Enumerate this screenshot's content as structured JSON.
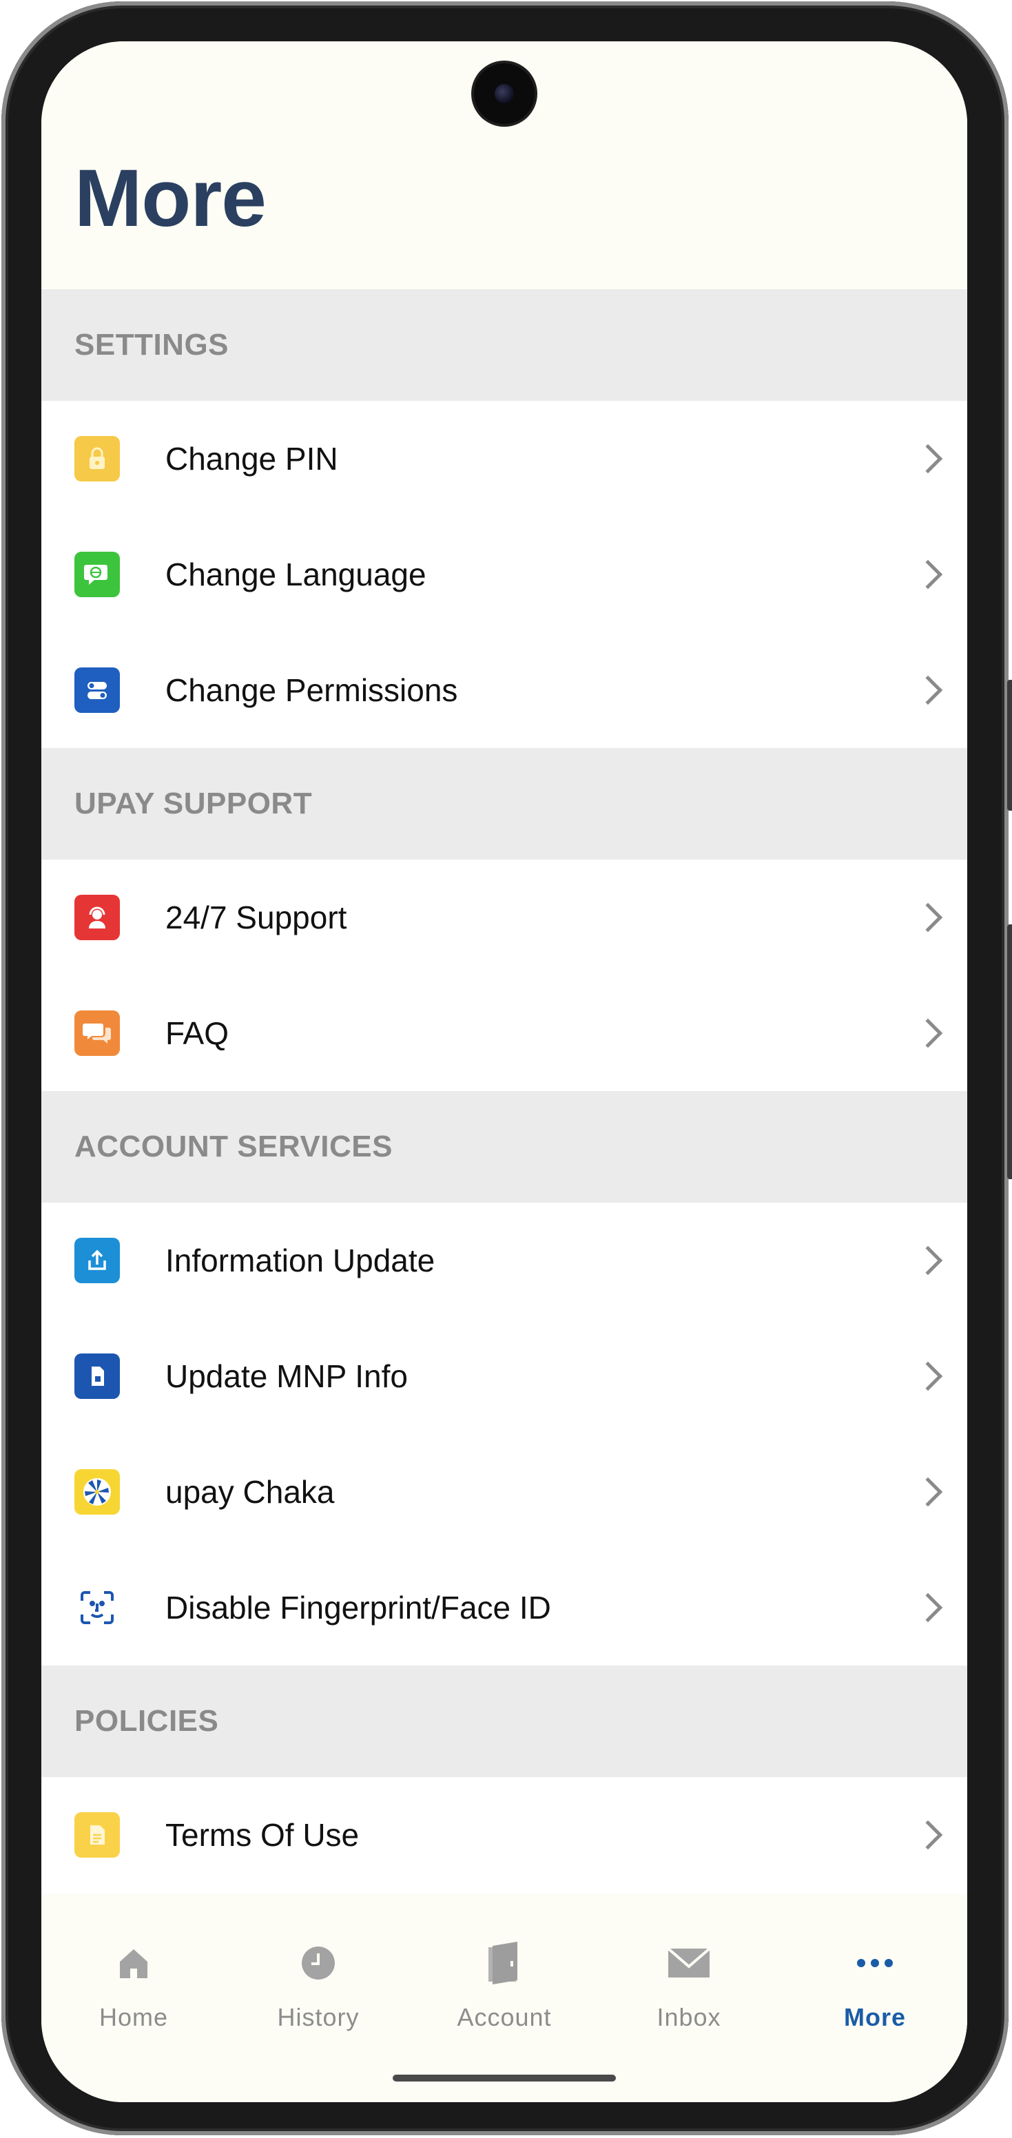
{
  "page": {
    "title": "More"
  },
  "sections": [
    {
      "title": "SETTINGS",
      "items": [
        {
          "label": "Change PIN",
          "icon": "lock-icon",
          "color": "#f7c948"
        },
        {
          "label": "Change Language",
          "icon": "language-icon",
          "color": "#3cc43c"
        },
        {
          "label": "Change Permissions",
          "icon": "toggle-icon",
          "color": "#1f5fbf"
        }
      ]
    },
    {
      "title": "UPAY SUPPORT",
      "items": [
        {
          "label": "24/7 Support",
          "icon": "headset-icon",
          "color": "#e63535"
        },
        {
          "label": "FAQ",
          "icon": "chat-bubbles-icon",
          "color": "#f08a3a"
        }
      ]
    },
    {
      "title": "ACCOUNT SERVICES",
      "items": [
        {
          "label": "Information Update",
          "icon": "upload-icon",
          "color": "#1c8fd6"
        },
        {
          "label": "Update MNP Info",
          "icon": "sim-card-icon",
          "color": "#1d56b0"
        },
        {
          "label": "upay Chaka",
          "icon": "wheel-icon",
          "color": "#f7d633"
        },
        {
          "label": "Disable Fingerprint/Face ID",
          "icon": "face-id-icon",
          "color": "#1d56b0"
        }
      ]
    },
    {
      "title": "POLICIES",
      "items": [
        {
          "label": "Terms Of Use",
          "icon": "document-icon",
          "color": "#fad24a"
        }
      ]
    }
  ],
  "bottom_nav": [
    {
      "label": "Home",
      "icon": "home-icon",
      "active": false
    },
    {
      "label": "History",
      "icon": "clock-icon",
      "active": false
    },
    {
      "label": "Account",
      "icon": "account-book-icon",
      "active": false
    },
    {
      "label": "Inbox",
      "icon": "envelope-icon",
      "active": false
    },
    {
      "label": "More",
      "icon": "more-dots-icon",
      "active": true
    }
  ],
  "colors": {
    "title": "#2b4060",
    "accent": "#1a5ca8",
    "section_bg": "#ebebeb",
    "header_bg": "#fdfdf5"
  }
}
